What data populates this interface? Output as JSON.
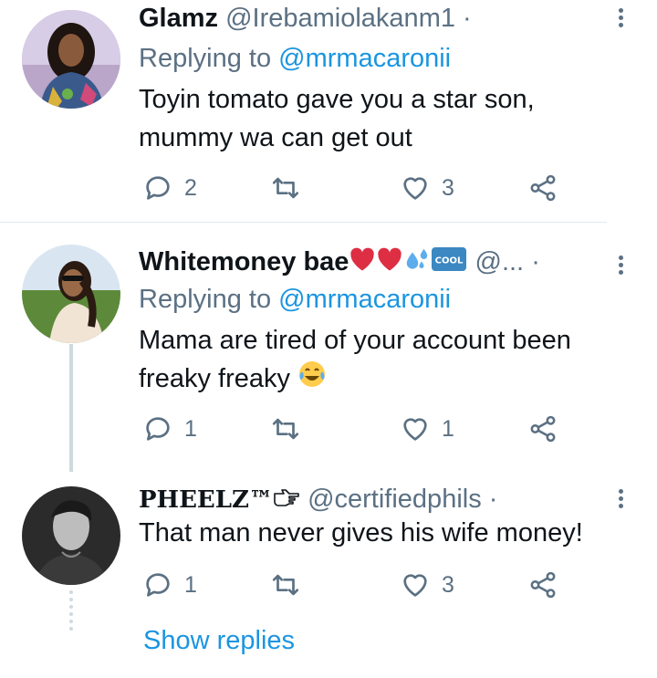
{
  "tweets": [
    {
      "name": "Glamz",
      "handle": "@Irebamiolakanm1",
      "separator": "·",
      "replying_label": "Replying to",
      "replying_to": "@mrmacaronii",
      "text_line1": "Toyin tomato gave you a star son,",
      "text_line2": "mummy wa can get out",
      "replies": "2",
      "retweets": "",
      "likes": "3"
    },
    {
      "name": "Whitemoney bae",
      "name_emojis": [
        "red-heart",
        "red-heart",
        "sweat-droplets",
        "cool-button"
      ],
      "cool_label": "COOL",
      "handle": "@...",
      "separator": "·",
      "replying_label": "Replying to",
      "replying_to": "@mrmacaronii",
      "text_line1": "Mama are tired of your account been",
      "text_line2": "freaky freaky",
      "text_emoji": "face-with-tears-of-joy",
      "replies": "1",
      "retweets": "",
      "likes": "1"
    },
    {
      "name": "PHEELZ™",
      "name_emoji": "backhand-index-pointing-right",
      "handle": "@certifiedphils",
      "separator": "·",
      "text_line1": "That man never gives his wife money!",
      "replies": "1",
      "retweets": "",
      "likes": "3"
    }
  ],
  "show_replies": "Show replies",
  "colors": {
    "primary_text": "#0f1419",
    "secondary_text": "#5b7083",
    "link": "#1b95e0",
    "heart_red": "#e0245e",
    "divider": "#e1e8ed"
  },
  "icons": [
    "reply-icon",
    "retweet-icon",
    "like-icon",
    "share-icon",
    "more-icon"
  ]
}
